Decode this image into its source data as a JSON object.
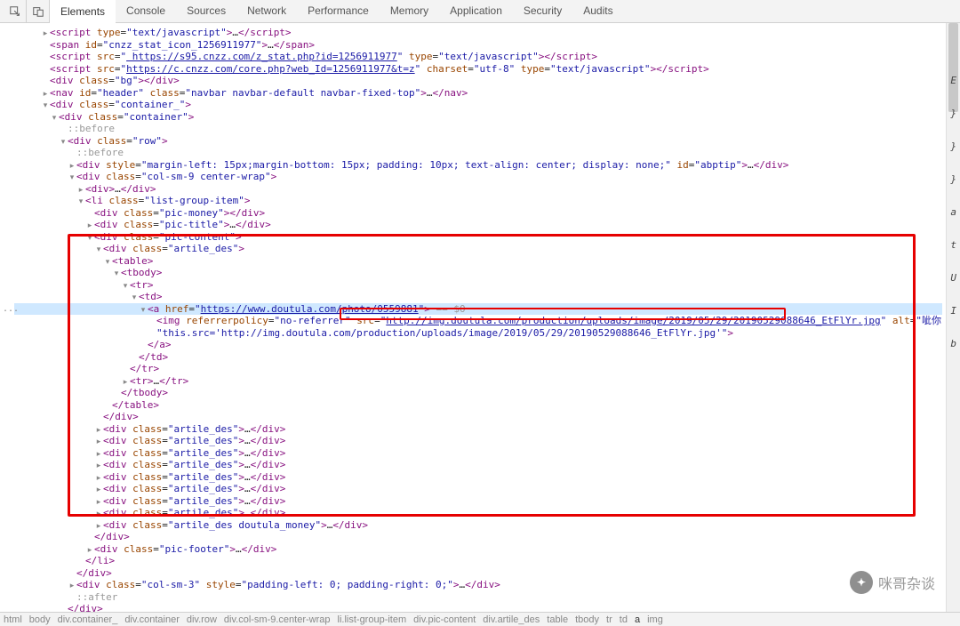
{
  "toolbar": {
    "tabs": [
      "Elements",
      "Console",
      "Sources",
      "Network",
      "Performance",
      "Memory",
      "Application",
      "Security",
      "Audits"
    ],
    "active": 0
  },
  "side_letters": [
    "E",
    "}",
    "}",
    "}",
    "a",
    "t",
    "U",
    "I",
    "b"
  ],
  "gutter_marker": "...",
  "tree": [
    {
      "indent": 3,
      "toggle": "▸",
      "html": "<span class='tag'>&lt;script</span> <span class='attr-name'>type</span>=<span class='attr-val'>\"text/javascript\"</span><span class='tag'>&gt;</span><span class='text'>…</span><span class='tag'>&lt;/script&gt;</span>"
    },
    {
      "indent": 3,
      "toggle": "",
      "html": "<span class='tag'>&lt;span</span> <span class='attr-name'>id</span>=<span class='attr-val'>\"cnzz_stat_icon_1256911977\"</span><span class='tag'>&gt;</span><span class='text'>…</span><span class='tag'>&lt;/span&gt;</span>"
    },
    {
      "indent": 3,
      "toggle": "",
      "html": "<span class='tag'>&lt;script</span> <span class='attr-name'>src</span>=<span class='attr-val'>\"</span><span class='link'>&nbsp;https://s95.cnzz.com/z_stat.php?id=1256911977</span><span class='attr-val'>\"</span> <span class='attr-name'>type</span>=<span class='attr-val'>\"text/javascript\"</span><span class='tag'>&gt;&lt;/script&gt;</span>"
    },
    {
      "indent": 3,
      "toggle": "",
      "html": "<span class='tag'>&lt;script</span> <span class='attr-name'>src</span>=<span class='attr-val'>\"</span><span class='link'>https://c.cnzz.com/core.php?web_Id=1256911977&amp;t=z</span><span class='attr-val'>\"</span> <span class='attr-name'>charset</span>=<span class='attr-val'>\"utf-8\"</span> <span class='attr-name'>type</span>=<span class='attr-val'>\"text/javascript\"</span><span class='tag'>&gt;&lt;/script&gt;</span>"
    },
    {
      "indent": 3,
      "toggle": "",
      "html": "<span class='tag'>&lt;div</span> <span class='attr-name'>class</span>=<span class='attr-val'>\"bg\"</span><span class='tag'>&gt;&lt;/div&gt;</span>"
    },
    {
      "indent": 3,
      "toggle": "▸",
      "html": "<span class='tag'>&lt;nav</span> <span class='attr-name'>id</span>=<span class='attr-val'>\"header\"</span> <span class='attr-name'>class</span>=<span class='attr-val'>\"navbar navbar-default navbar-fixed-top\"</span><span class='tag'>&gt;</span><span class='text'>…</span><span class='tag'>&lt;/nav&gt;</span>"
    },
    {
      "indent": 3,
      "toggle": "▾",
      "html": "<span class='tag'>&lt;div</span> <span class='attr-name'>class</span>=<span class='attr-val'>\"container_\"</span><span class='tag'>&gt;</span>"
    },
    {
      "indent": 4,
      "toggle": "▾",
      "html": "<span class='tag'>&lt;div</span> <span class='attr-name'>class</span>=<span class='attr-val'>\"container\"</span><span class='tag'>&gt;</span>"
    },
    {
      "indent": 5,
      "toggle": "",
      "html": "<span class='grey'>::before</span>"
    },
    {
      "indent": 5,
      "toggle": "▾",
      "html": "<span class='tag'>&lt;div</span> <span class='attr-name'>class</span>=<span class='attr-val'>\"row\"</span><span class='tag'>&gt;</span>"
    },
    {
      "indent": 6,
      "toggle": "",
      "html": "<span class='grey'>::before</span>"
    },
    {
      "indent": 6,
      "toggle": "▸",
      "html": "<span class='tag'>&lt;div</span> <span class='attr-name'>style</span>=<span class='attr-val'>\"margin-left: 15px;margin-bottom: 15px; padding: 10px; text-align: center; display: none;\"</span> <span class='attr-name'>id</span>=<span class='attr-val'>\"abptip\"</span><span class='tag'>&gt;</span><span class='text'>…</span><span class='tag'>&lt;/div&gt;</span>"
    },
    {
      "indent": 6,
      "toggle": "▾",
      "html": "<span class='tag'>&lt;div</span> <span class='attr-name'>class</span>=<span class='attr-val'>\"col-sm-9 center-wrap\"</span><span class='tag'>&gt;</span>"
    },
    {
      "indent": 7,
      "toggle": "▸",
      "html": "<span class='tag'>&lt;div&gt;</span><span class='text'>…</span><span class='tag'>&lt;/div&gt;</span>"
    },
    {
      "indent": 7,
      "toggle": "▾",
      "html": "<span class='tag'>&lt;li</span> <span class='attr-name'>class</span>=<span class='attr-val'>\"list-group-item\"</span><span class='tag'>&gt;</span>"
    },
    {
      "indent": 8,
      "toggle": "",
      "html": "<span class='tag'>&lt;div</span> <span class='attr-name'>class</span>=<span class='attr-val'>\"pic-money\"</span><span class='tag'>&gt;&lt;/div&gt;</span>"
    },
    {
      "indent": 8,
      "toggle": "▸",
      "html": "<span class='tag'>&lt;div</span> <span class='attr-name'>class</span>=<span class='attr-val'>\"pic-title\"</span><span class='tag'>&gt;</span><span class='text'>…</span><span class='tag'>&lt;/div&gt;</span>"
    },
    {
      "indent": 8,
      "toggle": "▾",
      "html": "<span class='tag'>&lt;div</span> <span class='attr-name'>class</span>=<span class='attr-val'>\"pic-content\"</span><span class='tag'>&gt;</span>"
    },
    {
      "indent": 9,
      "toggle": "▾",
      "html": "<span class='tag'>&lt;div</span> <span class='attr-name'>class</span>=<span class='attr-val'>\"artile_des\"</span><span class='tag'>&gt;</span>"
    },
    {
      "indent": 10,
      "toggle": "▾",
      "html": "<span class='tag'>&lt;table&gt;</span>"
    },
    {
      "indent": 11,
      "toggle": "▾",
      "html": "<span class='tag'>&lt;tbody&gt;</span>"
    },
    {
      "indent": 12,
      "toggle": "▾",
      "html": "<span class='tag'>&lt;tr&gt;</span>"
    },
    {
      "indent": 13,
      "toggle": "▾",
      "html": "<span class='tag'>&lt;td&gt;</span>"
    },
    {
      "indent": 14,
      "toggle": "▾",
      "hl": true,
      "html": "<span class='tag'>&lt;a</span> <span class='attr-name'>href</span>=<span class='attr-val'>\"</span><span class='link'>https://www.doutula.com/photo/0559881</span><span class='attr-val'>\"</span><span class='tag'>&gt;</span> <span class='grey'>== $0</span>"
    },
    {
      "indent": 15,
      "toggle": "",
      "html": "<span class='tag'>&lt;img</span> <span class='attr-name'>referrerpolicy</span>=<span class='attr-val'>\"no-referrer\"</span> <span class='attr-name'>src</span>=<span class='attr-val'>\"</span><span class='link'>http://img.doutula.com/production/uploads/image/2019/05/29/20190529088646_EtFlYr.jpg</span><span class='attr-val'>\"</span> <span class='attr-name'>alt</span>=<span class='attr-val'>\"呲你\"</span> <span class='attr-name'>onerror</span>="
    },
    {
      "indent": 15,
      "toggle": "",
      "html": "<span class='attr-val'>\"this.src='http://img.doutula.com/production/uploads/image/2019/05/29/20190529088646_EtFlYr.jpg'\"</span><span class='tag'>&gt;</span>"
    },
    {
      "indent": 14,
      "toggle": "",
      "html": "<span class='tag'>&lt;/a&gt;</span>"
    },
    {
      "indent": 13,
      "toggle": "",
      "html": "<span class='tag'>&lt;/td&gt;</span>"
    },
    {
      "indent": 12,
      "toggle": "",
      "html": "<span class='tag'>&lt;/tr&gt;</span>"
    },
    {
      "indent": 12,
      "toggle": "▸",
      "html": "<span class='tag'>&lt;tr&gt;</span><span class='text'>…</span><span class='tag'>&lt;/tr&gt;</span>"
    },
    {
      "indent": 11,
      "toggle": "",
      "html": "<span class='tag'>&lt;/tbody&gt;</span>"
    },
    {
      "indent": 10,
      "toggle": "",
      "html": "<span class='tag'>&lt;/table&gt;</span>"
    },
    {
      "indent": 9,
      "toggle": "",
      "html": "<span class='tag'>&lt;/div&gt;</span>"
    },
    {
      "indent": 9,
      "toggle": "▸",
      "html": "<span class='tag'>&lt;div</span> <span class='attr-name'>class</span>=<span class='attr-val'>\"artile_des\"</span><span class='tag'>&gt;</span><span class='text'>…</span><span class='tag'>&lt;/div&gt;</span>"
    },
    {
      "indent": 9,
      "toggle": "▸",
      "html": "<span class='tag'>&lt;div</span> <span class='attr-name'>class</span>=<span class='attr-val'>\"artile_des\"</span><span class='tag'>&gt;</span><span class='text'>…</span><span class='tag'>&lt;/div&gt;</span>"
    },
    {
      "indent": 9,
      "toggle": "▸",
      "html": "<span class='tag'>&lt;div</span> <span class='attr-name'>class</span>=<span class='attr-val'>\"artile_des\"</span><span class='tag'>&gt;</span><span class='text'>…</span><span class='tag'>&lt;/div&gt;</span>"
    },
    {
      "indent": 9,
      "toggle": "▸",
      "html": "<span class='tag'>&lt;div</span> <span class='attr-name'>class</span>=<span class='attr-val'>\"artile_des\"</span><span class='tag'>&gt;</span><span class='text'>…</span><span class='tag'>&lt;/div&gt;</span>"
    },
    {
      "indent": 9,
      "toggle": "▸",
      "html": "<span class='tag'>&lt;div</span> <span class='attr-name'>class</span>=<span class='attr-val'>\"artile_des\"</span><span class='tag'>&gt;</span><span class='text'>…</span><span class='tag'>&lt;/div&gt;</span>"
    },
    {
      "indent": 9,
      "toggle": "▸",
      "html": "<span class='tag'>&lt;div</span> <span class='attr-name'>class</span>=<span class='attr-val'>\"artile_des\"</span><span class='tag'>&gt;</span><span class='text'>…</span><span class='tag'>&lt;/div&gt;</span>"
    },
    {
      "indent": 9,
      "toggle": "▸",
      "html": "<span class='tag'>&lt;div</span> <span class='attr-name'>class</span>=<span class='attr-val'>\"artile_des\"</span><span class='tag'>&gt;</span><span class='text'>…</span><span class='tag'>&lt;/div&gt;</span>"
    },
    {
      "indent": 9,
      "toggle": "▸",
      "html": "<span class='tag'>&lt;div</span> <span class='attr-name'>class</span>=<span class='attr-val'>\"artile_des\"</span><span class='tag'>&gt;</span><span class='text'>…</span><span class='tag'>&lt;/div&gt;</span>"
    },
    {
      "indent": 9,
      "toggle": "▸",
      "html": "<span class='tag'>&lt;div</span> <span class='attr-name'>class</span>=<span class='attr-val'>\"artile_des doutula_money\"</span><span class='tag'>&gt;</span><span class='text'>…</span><span class='tag'>&lt;/div&gt;</span>"
    },
    {
      "indent": 8,
      "toggle": "",
      "html": "<span class='tag'>&lt;/div&gt;</span>"
    },
    {
      "indent": 8,
      "toggle": "▸",
      "html": "<span class='tag'>&lt;div</span> <span class='attr-name'>class</span>=<span class='attr-val'>\"pic-footer\"</span><span class='tag'>&gt;</span><span class='text'>…</span><span class='tag'>&lt;/div&gt;</span>"
    },
    {
      "indent": 7,
      "toggle": "",
      "html": "<span class='tag'>&lt;/li&gt;</span>"
    },
    {
      "indent": 6,
      "toggle": "",
      "html": "<span class='tag'>&lt;/div&gt;</span>"
    },
    {
      "indent": 6,
      "toggle": "▸",
      "html": "<span class='tag'>&lt;div</span> <span class='attr-name'>class</span>=<span class='attr-val'>\"col-sm-3\"</span> <span class='attr-name'>style</span>=<span class='attr-val'>\"padding-left: 0; padding-right: 0;\"</span><span class='tag'>&gt;</span><span class='text'>…</span><span class='tag'>&lt;/div&gt;</span>"
    },
    {
      "indent": 6,
      "toggle": "",
      "html": "<span class='grey'>::after</span>"
    },
    {
      "indent": 5,
      "toggle": "",
      "html": "<span class='tag'>&lt;/div&gt;</span>"
    }
  ],
  "breadcrumbs": [
    "html",
    "body",
    "div.container_",
    "div.container",
    "div.row",
    "div.col-sm-9.center-wrap",
    "li.list-group-item",
    "div.pic-content",
    "div.artile_des",
    "table",
    "tbody",
    "tr",
    "td",
    "a",
    "img"
  ],
  "breadcrumb_selected": 13,
  "watermark": "咪哥杂谈"
}
